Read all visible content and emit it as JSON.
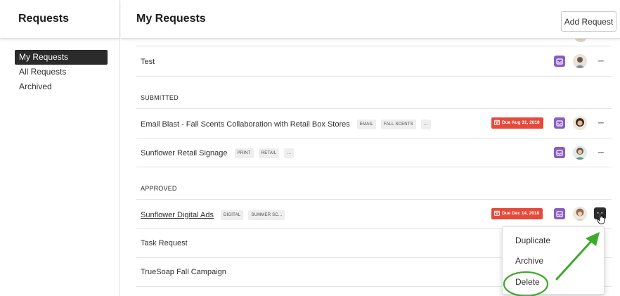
{
  "sidebar": {
    "title": "Requests",
    "items": [
      {
        "label": "My Requests"
      },
      {
        "label": "All Requests"
      },
      {
        "label": "Archived"
      }
    ]
  },
  "main": {
    "title": "My Requests",
    "add_button_label": "Add Request"
  },
  "sections": {
    "submitted": "SUBMITTED",
    "approved": "APPROVED"
  },
  "requests": [
    {
      "title": "Test",
      "tags": []
    },
    {
      "title": "Email Blast - Fall Scents Collaboration with Retail Box Stores",
      "tags": [
        "EMAIL",
        "FALL SCENTS",
        "..."
      ],
      "due": "Due Aug 31, 2018"
    },
    {
      "title": "Sunflower Retail Signage",
      "tags": [
        "PRINT",
        "RETAIL",
        "..."
      ]
    },
    {
      "title": "Sunflower Digital Ads",
      "tags": [
        "DIGITAL",
        "SUMMER SC..."
      ],
      "due": "Due Dec 14, 2018"
    },
    {
      "title": "Task Request",
      "tags": []
    },
    {
      "title": "TrueSoap Fall Campaign",
      "tags": []
    }
  ],
  "more_label": "···",
  "context_menu": {
    "items": [
      {
        "label": "Duplicate"
      },
      {
        "label": "Archive"
      },
      {
        "label": "Delete"
      }
    ]
  },
  "colors": {
    "due_badge": "#e64a3b",
    "inbox_button": "#8b5cc4",
    "active_nav": "#2b2b2b",
    "highlight_green": "#3daa2b"
  },
  "icons": [
    "inbox-icon",
    "calendar-icon",
    "more-icon",
    "pointer-hand-icon",
    "arrow-icon"
  ]
}
